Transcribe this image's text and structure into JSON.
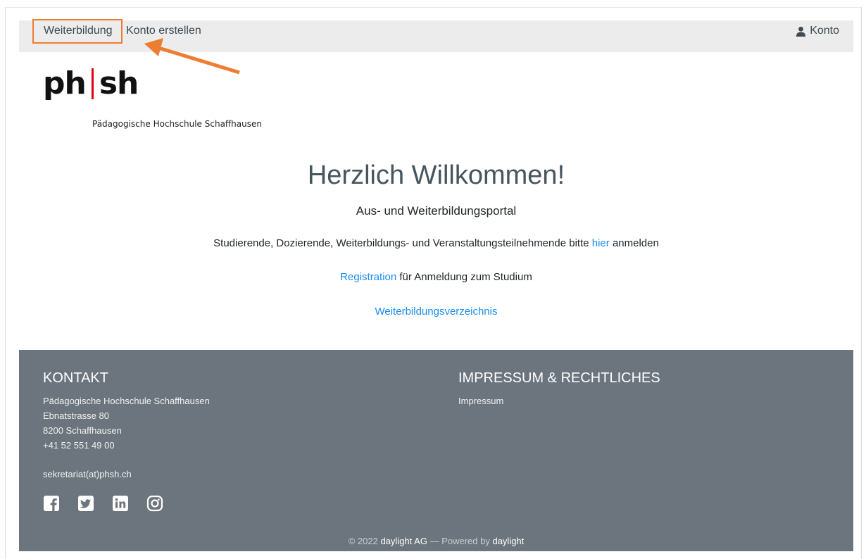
{
  "nav": {
    "left_items": [
      "Weiterbildung",
      "Konto erstellen"
    ],
    "account_label": "Konto"
  },
  "logo": {
    "mark_left": "ph",
    "mark_right": "sh",
    "subtitle": "Pädagogische Hochschule Schaffhausen"
  },
  "main": {
    "heading": "Herzlich Willkommen!",
    "subheading": "Aus- und Weiterbildungsportal",
    "login_text_before": "Studierende, Dozierende, Weiterbildungs- und Veranstaltungsteilnehmende bitte",
    "login_link": "hier",
    "login_text_after": "anmelden",
    "registration_link": "Registration",
    "registration_text": "für Anmeldung zum Studium",
    "catalog_link": "Weiterbildungsverzeichnis"
  },
  "footer": {
    "contact_heading": "KONTAKT",
    "address_lines": [
      "Pädagogische Hochschule Schaffhausen",
      "Ebnatstrasse 80",
      "8200 Schaffhausen",
      "+41 52 551 49 00"
    ],
    "email": "sekretariat(at)phsh.ch",
    "legal_heading": "IMPRESSUM & RECHTLICHES",
    "legal_link": "Impressum",
    "social_icons": [
      "facebook-icon",
      "twitter-icon",
      "linkedin-icon",
      "instagram-icon"
    ],
    "copyright_prefix": "© 2022",
    "copyright_company": "daylight AG",
    "copyright_mid": "— Powered by",
    "copyright_brand": "daylight"
  },
  "colors": {
    "accent_annotation": "#ed7d31",
    "link": "#1a8cf0",
    "footer_bg": "#6c757d",
    "navbar_bg": "#ececec",
    "logo_bar": "#e2001a"
  }
}
